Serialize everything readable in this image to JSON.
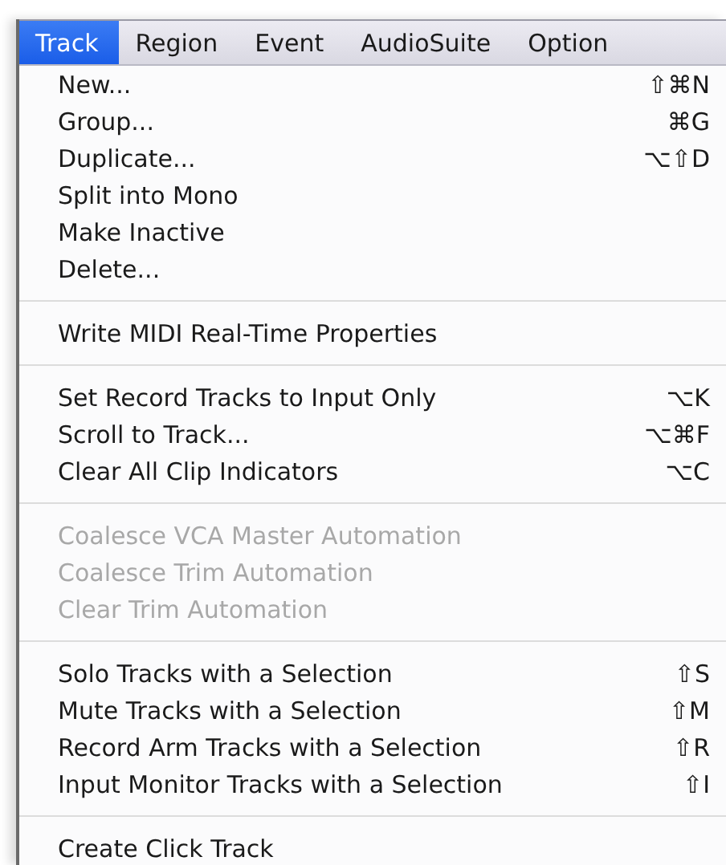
{
  "menu_bar": [
    {
      "label": "Track",
      "selected": true
    },
    {
      "label": "Region",
      "selected": false
    },
    {
      "label": "Event",
      "selected": false
    },
    {
      "label": "AudioSuite",
      "selected": false
    },
    {
      "label": "Option",
      "selected": false
    }
  ],
  "menu": {
    "groups": [
      [
        {
          "label": "New...",
          "shortcut": "⇧⌘N",
          "disabled": false
        },
        {
          "label": "Group...",
          "shortcut": "⌘G",
          "disabled": false
        },
        {
          "label": "Duplicate...",
          "shortcut": "⌥⇧D",
          "disabled": false
        },
        {
          "label": "Split into Mono",
          "disabled": false
        },
        {
          "label": "Make Inactive",
          "disabled": false
        },
        {
          "label": "Delete...",
          "disabled": false
        }
      ],
      [
        {
          "label": "Write MIDI Real-Time Properties",
          "disabled": false
        }
      ],
      [
        {
          "label": "Set Record Tracks to Input Only",
          "shortcut": "⌥K",
          "disabled": false
        },
        {
          "label": "Scroll to Track...",
          "shortcut": "⌥⌘F",
          "disabled": false
        },
        {
          "label": "Clear All Clip Indicators",
          "shortcut": "⌥C",
          "disabled": false
        }
      ],
      [
        {
          "label": "Coalesce VCA Master Automation",
          "disabled": true
        },
        {
          "label": "Coalesce Trim Automation",
          "disabled": true
        },
        {
          "label": "Clear Trim Automation",
          "disabled": true
        }
      ],
      [
        {
          "label": "Solo Tracks with a Selection",
          "shortcut": "⇧S",
          "disabled": false
        },
        {
          "label": "Mute Tracks with a Selection",
          "shortcut": "⇧M",
          "disabled": false
        },
        {
          "label": "Record Arm Tracks with a Selection",
          "shortcut": "⇧R",
          "disabled": false
        },
        {
          "label": "Input Monitor Tracks with a Selection",
          "shortcut": "⇧I",
          "disabled": false
        }
      ],
      [
        {
          "label": "Create Click Track",
          "disabled": false
        }
      ]
    ]
  }
}
